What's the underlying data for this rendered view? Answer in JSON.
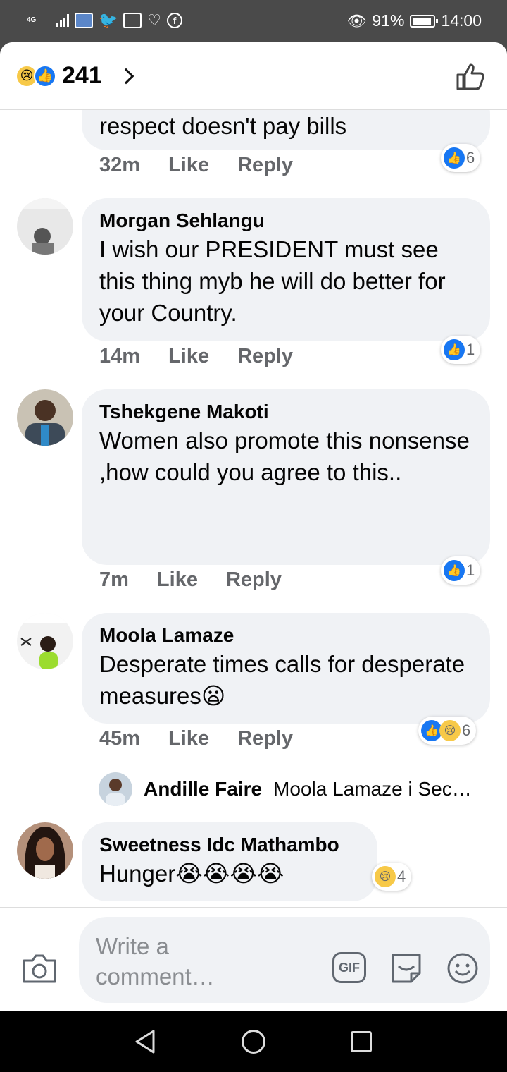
{
  "status_bar": {
    "network": "4G",
    "battery": "91%",
    "time": "14:00",
    "icons": [
      "signal-icon",
      "wallpaper-icon",
      "twitter-icon",
      "calendar-icon",
      "heart-icon",
      "facebook-icon",
      "eye-icon",
      "battery-icon"
    ]
  },
  "header": {
    "reactions": [
      "sad",
      "like"
    ],
    "reaction_count": "241"
  },
  "comments": [
    {
      "name": "",
      "text": "respect doesn't pay bills",
      "time": "32m",
      "like": "Like",
      "reply": "Reply",
      "reactions": [
        "like"
      ],
      "reaction_count": "6"
    },
    {
      "name": "Morgan Sehlangu",
      "text": "I wish  our PRESIDENT must see this thing myb he will do better for your Country.",
      "time": "14m",
      "like": "Like",
      "reply": "Reply",
      "reactions": [
        "like"
      ],
      "reaction_count": "1"
    },
    {
      "name": "Tshekgene Makoti",
      "text": "Women also promote this nonsense  ,how could you agree to this..",
      "time": "7m",
      "like": "Like",
      "reply": "Reply",
      "reactions": [
        "like"
      ],
      "reaction_count": "1"
    },
    {
      "name": "Moola Lamaze",
      "text": "Desperate times calls for desperate measures😦",
      "time": "45m",
      "like": "Like",
      "reply": "Reply",
      "reactions": [
        "like",
        "sad"
      ],
      "reaction_count": "6",
      "reply_preview": {
        "name": "Andille Faire",
        "text": "Moola Lamaze i Sec…"
      }
    },
    {
      "name": "Sweetness Idc Mathambo",
      "text": "Hunger😭😭😭😭",
      "reactions": [
        "sad"
      ],
      "reaction_count": "4"
    }
  ],
  "composer": {
    "placeholder": "Write a comment…",
    "gif_label": "GIF"
  }
}
